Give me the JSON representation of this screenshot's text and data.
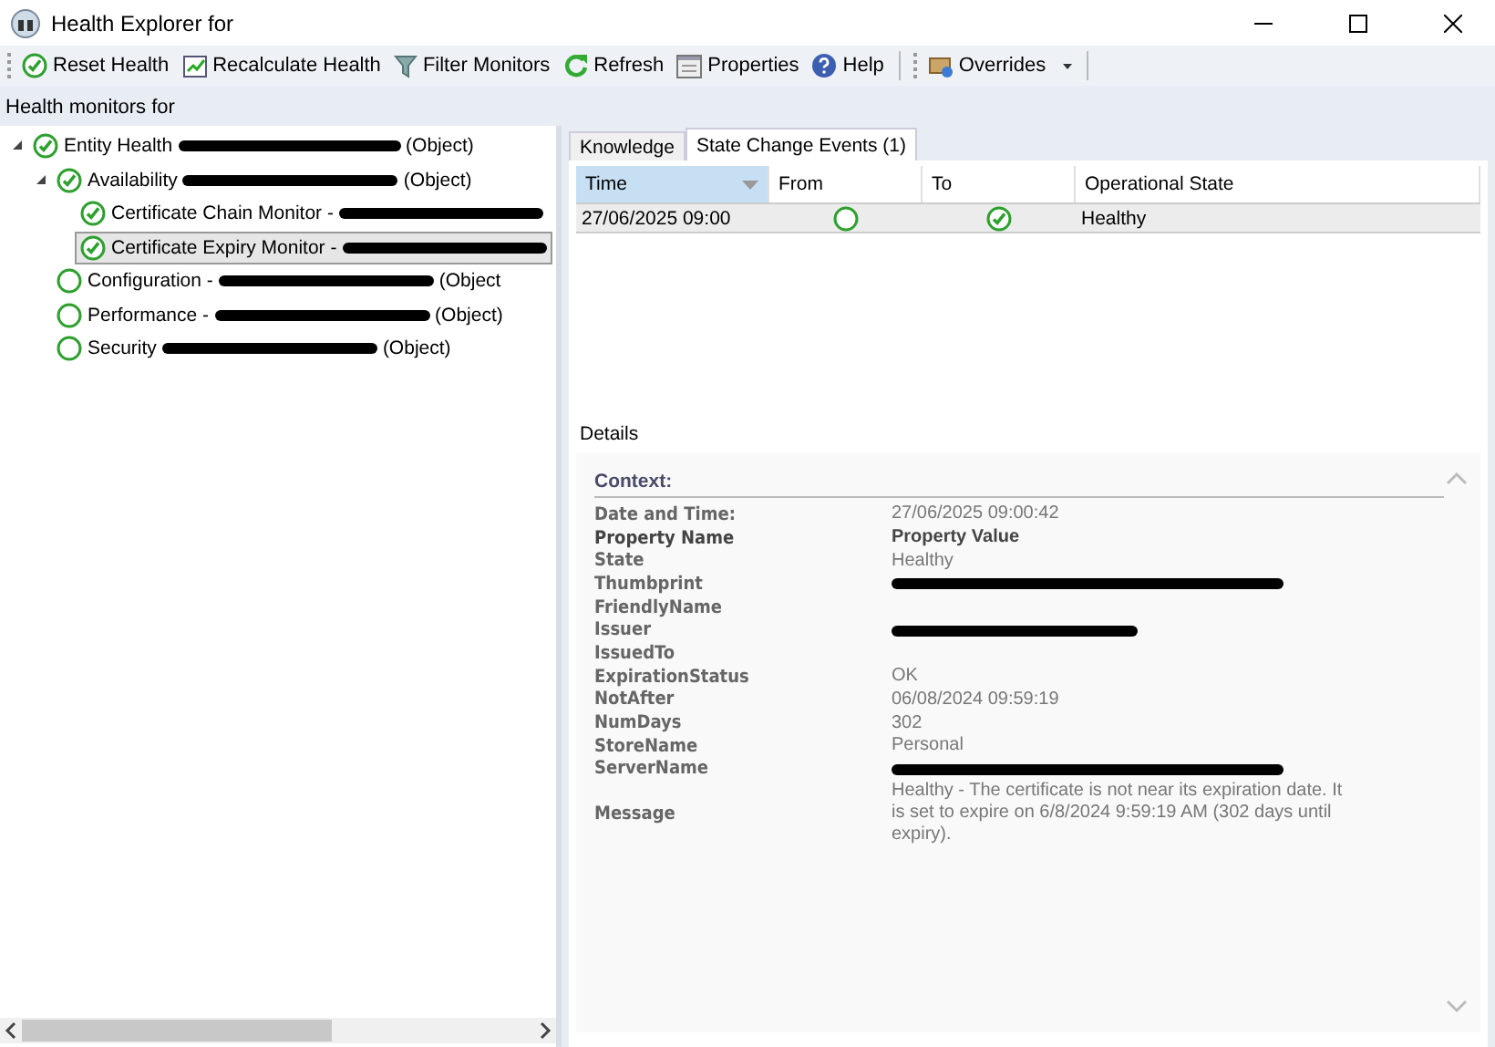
{
  "window": {
    "title": "Health Explorer for"
  },
  "toolbar": [
    {
      "label": "Reset Health"
    },
    {
      "label": "Recalculate Health"
    },
    {
      "label": "Filter Monitors"
    },
    {
      "label": "Refresh"
    },
    {
      "label": "Properties"
    },
    {
      "label": "Help"
    },
    {
      "label": "Overrides",
      "dropdown": true
    }
  ],
  "monitors_label": "Health monitors for",
  "tree": [
    {
      "label": "Entity Health",
      "redacted": true,
      "suffix": "(Object)",
      "healthy": true,
      "expanded": true,
      "selected": false,
      "children": [
        {
          "label": "Availability",
          "redacted": true,
          "suffix": "(Object)",
          "healthy": true,
          "expanded": true,
          "selected": false,
          "children": [
            {
              "label": "Certificate Chain Monitor -",
              "redacted": true,
              "healthy": true,
              "selected": false
            },
            {
              "label": "Certificate Expiry Monitor -",
              "redacted": true,
              "healthy": true,
              "selected": true
            }
          ]
        },
        {
          "label": "Configuration -",
          "redacted": true,
          "suffix": "(Object",
          "healthy": false,
          "selected": false
        },
        {
          "label": "Performance -",
          "redacted": true,
          "suffix": "(Object)",
          "healthy": false,
          "selected": false
        },
        {
          "label": "Security",
          "redacted": true,
          "suffix": "(Object)",
          "healthy": false,
          "selected": false
        }
      ]
    }
  ],
  "tabs": [
    {
      "label": "Knowledge",
      "selected": false
    },
    {
      "label": "State Change Events (1)",
      "selected": true
    }
  ],
  "events_table": {
    "columns": [
      {
        "label": "Time",
        "sorted": true
      },
      {
        "label": "From",
        "sorted": false
      },
      {
        "label": "To",
        "sorted": false
      },
      {
        "label": "Operational State",
        "sorted": false
      }
    ],
    "rows": [
      {
        "time": "27/06/2025 09:00",
        "from_healthy": false,
        "to_healthy": true,
        "state": "Healthy",
        "selected": true
      }
    ]
  },
  "details": {
    "label": "Details",
    "context": "Context:",
    "date_label": "Date and Time:",
    "date_value": "27/06/2025 09:00:42",
    "header": {
      "name": "Property Name",
      "value": "Property Value"
    },
    "properties": [
      {
        "name": "State",
        "value": "Healthy"
      },
      {
        "name": "Thumbprint",
        "redacted": true
      },
      {
        "name": "FriendlyName"
      },
      {
        "name": "Issuer",
        "redacted": true
      },
      {
        "name": "IssuedTo"
      },
      {
        "name": "ExpirationStatus",
        "value": "OK"
      },
      {
        "name": "NotAfter",
        "value": "06/08/2024 09:59:19"
      },
      {
        "name": "NumDays",
        "value": "302"
      },
      {
        "name": "StoreName",
        "value": "Personal"
      },
      {
        "name": "ServerName",
        "redacted": true
      },
      {
        "name": "Message",
        "value": "Healthy - The certificate is not near its expiration date. It is set to expire on 6/8/2024 9:59:19 AM (302 days until expiry)."
      }
    ]
  }
}
